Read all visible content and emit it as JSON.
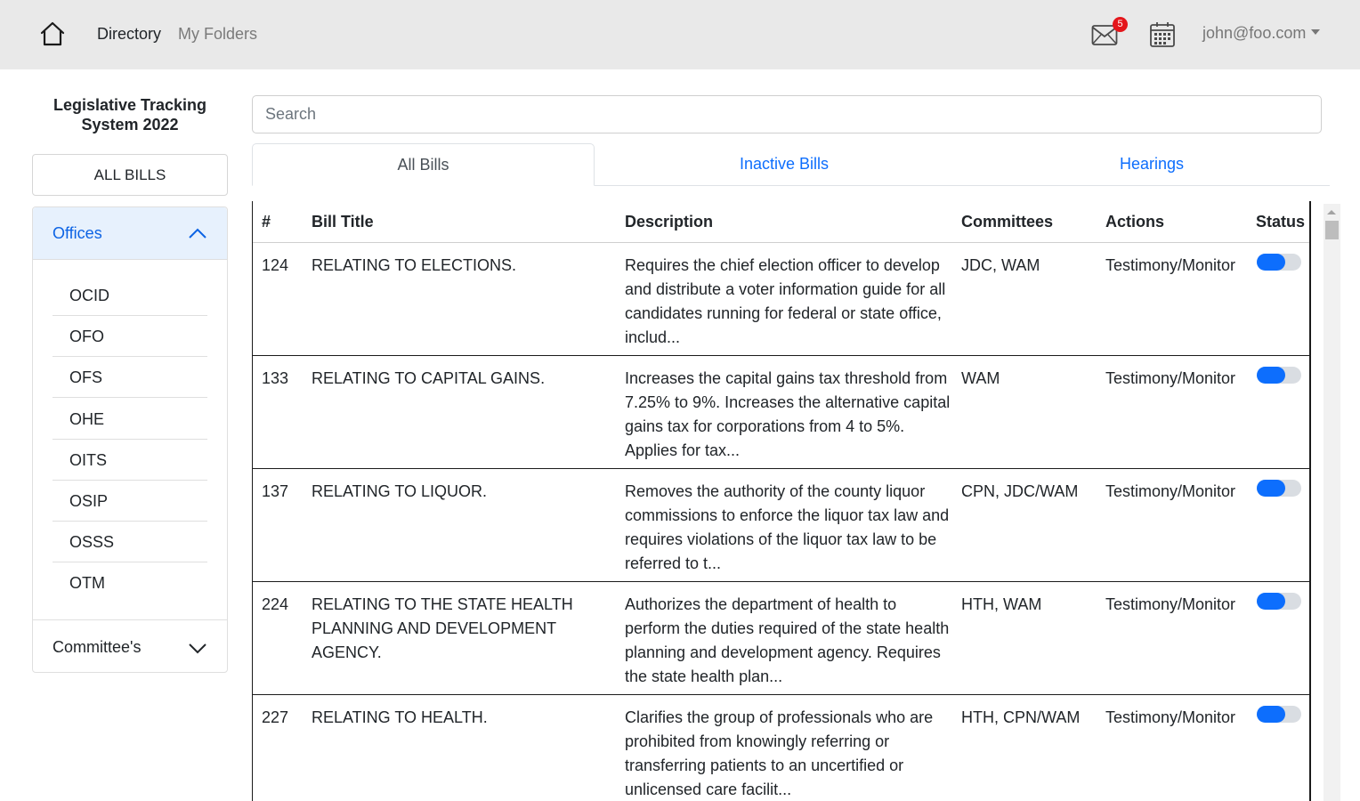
{
  "nav": {
    "home_icon": "home-icon",
    "directory_label": "Directory",
    "folders_label": "My Folders",
    "mail_icon": "envelope-icon",
    "mail_badge_count": "5",
    "calendar_icon": "calendar-icon",
    "user_email": "john@foo.com"
  },
  "sidebar": {
    "title": "Legislative Tracking System 2022",
    "all_bills_label": "ALL BILLS",
    "offices_header": "Offices",
    "offices": [
      "OCID",
      "OFO",
      "OFS",
      "OHE",
      "OITS",
      "OSIP",
      "OSSS",
      "OTM"
    ],
    "committees_header": "Committee's"
  },
  "search": {
    "placeholder": "Search",
    "value": ""
  },
  "tabs": [
    {
      "label": "All Bills",
      "active": true
    },
    {
      "label": "Inactive Bills",
      "active": false
    },
    {
      "label": "Hearings",
      "active": false
    }
  ],
  "table": {
    "columns": [
      "#",
      "Bill Title",
      "Description",
      "Committees",
      "Actions",
      "Status"
    ],
    "rows": [
      {
        "number": "124",
        "title": "RELATING TO ELECTIONS.",
        "description": "Requires the chief election officer to develop and distribute a voter information guide for all candidates running for federal or state office, includ...",
        "committees": "JDC, WAM",
        "actions": "Testimony/Monitor",
        "status_on": true
      },
      {
        "number": "133",
        "title": "RELATING TO CAPITAL GAINS.",
        "description": "Increases the capital gains tax threshold from 7.25% to 9%. Increases the alternative capital gains tax for corporations from 4 to 5%. Applies for tax...",
        "committees": "WAM",
        "actions": "Testimony/Monitor",
        "status_on": true
      },
      {
        "number": "137",
        "title": "RELATING TO LIQUOR.",
        "description": "Removes the authority of the county liquor commissions to enforce the liquor tax law and requires violations of the liquor tax law to be referred to t...",
        "committees": "CPN, JDC/WAM",
        "actions": "Testimony/Monitor",
        "status_on": true
      },
      {
        "number": "224",
        "title": "RELATING TO THE STATE HEALTH PLANNING AND DEVELOPMENT AGENCY.",
        "description": "Authorizes the department of health to perform the duties required of the state health planning and development agency. Requires the state health plan...",
        "committees": "HTH, WAM",
        "actions": "Testimony/Monitor",
        "status_on": true
      },
      {
        "number": "227",
        "title": "RELATING TO HEALTH.",
        "description": "Clarifies the group of professionals who are prohibited from knowingly referring or transferring patients to an uncertified or unlicensed care facilit...",
        "committees": "HTH, CPN/WAM",
        "actions": "Testimony/Monitor",
        "status_on": true
      }
    ]
  },
  "colors": {
    "topbar_bg": "#e9e9e9",
    "accent": "#0d6efd",
    "active_header_bg": "#e7f1fd",
    "badge": "#e4161b"
  }
}
